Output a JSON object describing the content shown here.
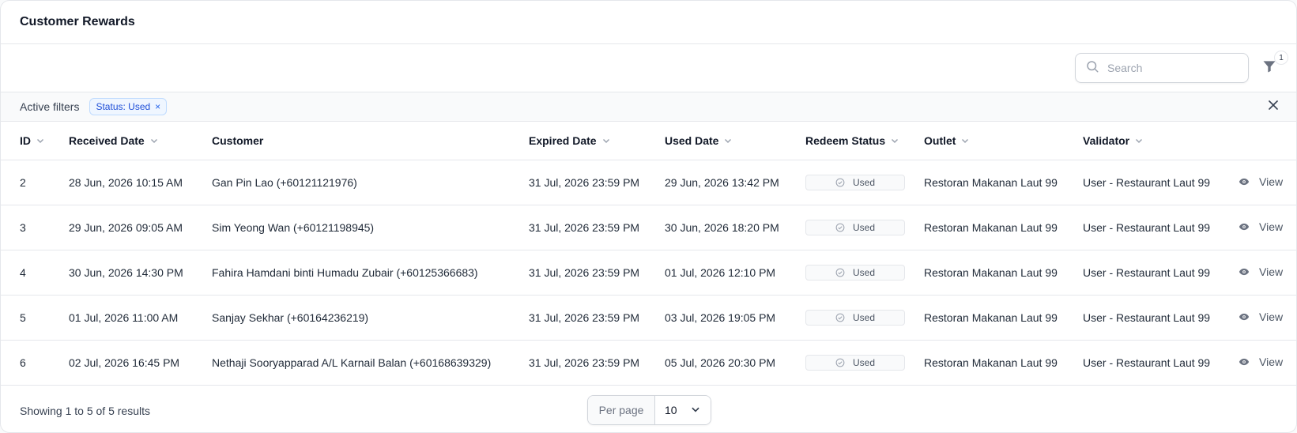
{
  "header": {
    "title": "Customer Rewards"
  },
  "toolbar": {
    "search_placeholder": "Search",
    "filter_count": "1"
  },
  "active_filters": {
    "label": "Active filters",
    "chips": [
      {
        "label": "Status: Used",
        "remove": "×"
      }
    ]
  },
  "table": {
    "columns": [
      {
        "label": "ID"
      },
      {
        "label": "Received Date"
      },
      {
        "label": "Customer"
      },
      {
        "label": "Expired Date"
      },
      {
        "label": "Used Date"
      },
      {
        "label": "Redeem Status"
      },
      {
        "label": "Outlet"
      },
      {
        "label": "Validator"
      }
    ],
    "rows": [
      {
        "id": "2",
        "received": "28 Jun, 2026 10:15 AM",
        "customer": "Gan Pin Lao (+60121121976)",
        "expired": "31 Jul, 2026 23:59 PM",
        "used": "29 Jun, 2026 13:42 PM",
        "status": "Used",
        "outlet": "Restoran Makanan Laut 99",
        "validator": "User - Restaurant Laut 99",
        "action": "View"
      },
      {
        "id": "3",
        "received": "29 Jun, 2026 09:05 AM",
        "customer": "Sim Yeong Wan (+60121198945)",
        "expired": "31 Jul, 2026 23:59 PM",
        "used": "30 Jun, 2026 18:20 PM",
        "status": "Used",
        "outlet": "Restoran Makanan Laut 99",
        "validator": "User - Restaurant Laut 99",
        "action": "View"
      },
      {
        "id": "4",
        "received": "30 Jun, 2026 14:30 PM",
        "customer": "Fahira Hamdani binti Humadu Zubair (+60125366683)",
        "expired": "31 Jul, 2026 23:59 PM",
        "used": "01 Jul, 2026 12:10 PM",
        "status": "Used",
        "outlet": "Restoran Makanan Laut 99",
        "validator": "User - Restaurant Laut 99",
        "action": "View"
      },
      {
        "id": "5",
        "received": "01 Jul, 2026 11:00 AM",
        "customer": "Sanjay Sekhar (+60164236219)",
        "expired": "31 Jul, 2026 23:59 PM",
        "used": "03 Jul, 2026 19:05 PM",
        "status": "Used",
        "outlet": "Restoran Makanan Laut 99",
        "validator": "User - Restaurant Laut 99",
        "action": "View"
      },
      {
        "id": "6",
        "received": "02 Jul, 2026 16:45 PM",
        "customer": "Nethaji Sooryapparad A/L Karnail Balan (+60168639329)",
        "expired": "31 Jul, 2026 23:59 PM",
        "used": "05 Jul, 2026 20:30 PM",
        "status": "Used",
        "outlet": "Restoran Makanan Laut 99",
        "validator": "User - Restaurant Laut 99",
        "action": "View"
      }
    ]
  },
  "footer": {
    "showing": "Showing 1 to 5 of 5 results",
    "per_page_label": "Per page",
    "per_page_value": "10"
  },
  "colors": {
    "accent": "#1d4ed8",
    "border": "#e5e7eb",
    "chip_bg": "#eff6ff"
  }
}
